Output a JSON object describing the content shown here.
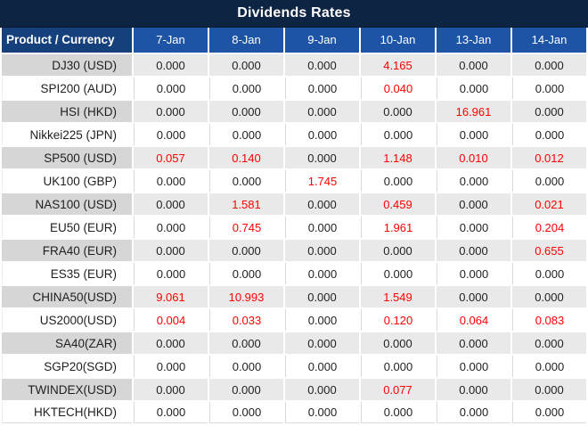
{
  "title": "Dividends Rates",
  "colors": {
    "title_bg": "#0E2443",
    "corner_bg": "#15407C",
    "date_bg": "#1D54A6",
    "stripe_product": "#D6D6D6",
    "stripe_value": "#E9E9E9",
    "red": "#FF0000",
    "text": "#1F1F1F",
    "divider": "#D9D9D9",
    "page_bg": "#FFFFFF"
  },
  "table": {
    "corner_header": "Product / Currency",
    "date_headers": [
      "7-Jan",
      "8-Jan",
      "9-Jan",
      "10-Jan",
      "13-Jan",
      "14-Jan"
    ],
    "zero_value": "0.000",
    "rows": [
      {
        "product": "DJ30 (USD)",
        "values": [
          "0.000",
          "0.000",
          "0.000",
          "4.165",
          "0.000",
          "0.000"
        ]
      },
      {
        "product": "SPI200 (AUD)",
        "values": [
          "0.000",
          "0.000",
          "0.000",
          "0.040",
          "0.000",
          "0.000"
        ]
      },
      {
        "product": "HSI (HKD)",
        "values": [
          "0.000",
          "0.000",
          "0.000",
          "0.000",
          "16.961",
          "0.000"
        ]
      },
      {
        "product": "Nikkei225 (JPN)",
        "values": [
          "0.000",
          "0.000",
          "0.000",
          "0.000",
          "0.000",
          "0.000"
        ]
      },
      {
        "product": "SP500 (USD)",
        "values": [
          "0.057",
          "0.140",
          "0.000",
          "1.148",
          "0.010",
          "0.012"
        ]
      },
      {
        "product": "UK100 (GBP)",
        "values": [
          "0.000",
          "0.000",
          "1.745",
          "0.000",
          "0.000",
          "0.000"
        ]
      },
      {
        "product": "NAS100 (USD)",
        "values": [
          "0.000",
          "1.581",
          "0.000",
          "0.459",
          "0.000",
          "0.021"
        ]
      },
      {
        "product": "EU50 (EUR)",
        "values": [
          "0.000",
          "0.745",
          "0.000",
          "1.961",
          "0.000",
          "0.204"
        ]
      },
      {
        "product": "FRA40 (EUR)",
        "values": [
          "0.000",
          "0.000",
          "0.000",
          "0.000",
          "0.000",
          "0.655"
        ]
      },
      {
        "product": "ES35 (EUR)",
        "values": [
          "0.000",
          "0.000",
          "0.000",
          "0.000",
          "0.000",
          "0.000"
        ]
      },
      {
        "product": "CHINA50(USD)",
        "values": [
          "9.061",
          "10.993",
          "0.000",
          "1.549",
          "0.000",
          "0.000"
        ]
      },
      {
        "product": "US2000(USD)",
        "values": [
          "0.004",
          "0.033",
          "0.000",
          "0.120",
          "0.064",
          "0.083"
        ]
      },
      {
        "product": "SA40(ZAR)",
        "values": [
          "0.000",
          "0.000",
          "0.000",
          "0.000",
          "0.000",
          "0.000"
        ]
      },
      {
        "product": "SGP20(SGD)",
        "values": [
          "0.000",
          "0.000",
          "0.000",
          "0.000",
          "0.000",
          "0.000"
        ]
      },
      {
        "product": "TWINDEX(USD)",
        "values": [
          "0.000",
          "0.000",
          "0.000",
          "0.077",
          "0.000",
          "0.000"
        ]
      },
      {
        "product": "HKTECH(HKD)",
        "values": [
          "0.000",
          "0.000",
          "0.000",
          "0.000",
          "0.000",
          "0.000"
        ]
      }
    ]
  }
}
